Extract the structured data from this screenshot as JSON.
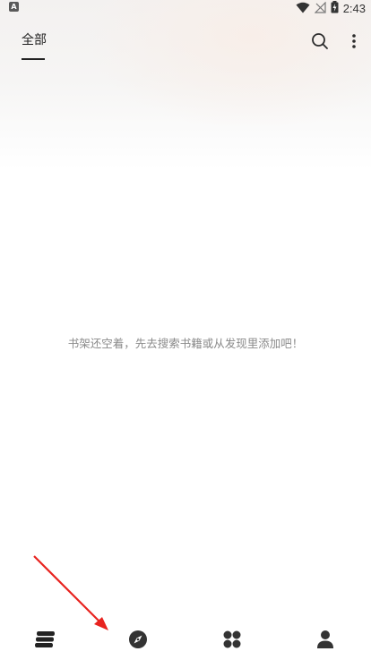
{
  "status_bar": {
    "time": "2:43",
    "app_icon": "A",
    "icons": [
      "wifi-icon",
      "signal-off-icon",
      "battery-charging-icon"
    ]
  },
  "top_bar": {
    "tab_label": "全部",
    "icons": [
      "search-icon",
      "more-vertical-icon"
    ]
  },
  "main": {
    "empty_message": "书架还空着，先去搜索书籍或从发现里添加吧！"
  },
  "bottom_nav": {
    "items": [
      {
        "name": "bookshelf",
        "icon": "bookshelf-icon",
        "active": true
      },
      {
        "name": "discover",
        "icon": "compass-icon",
        "active": false
      },
      {
        "name": "apps",
        "icon": "grid-icon",
        "active": false
      },
      {
        "name": "profile",
        "icon": "person-icon",
        "active": false
      }
    ]
  },
  "colors": {
    "annotation_arrow": "#e8231f",
    "icon": "#2b2b2b",
    "empty_text": "#8a8a8a"
  }
}
